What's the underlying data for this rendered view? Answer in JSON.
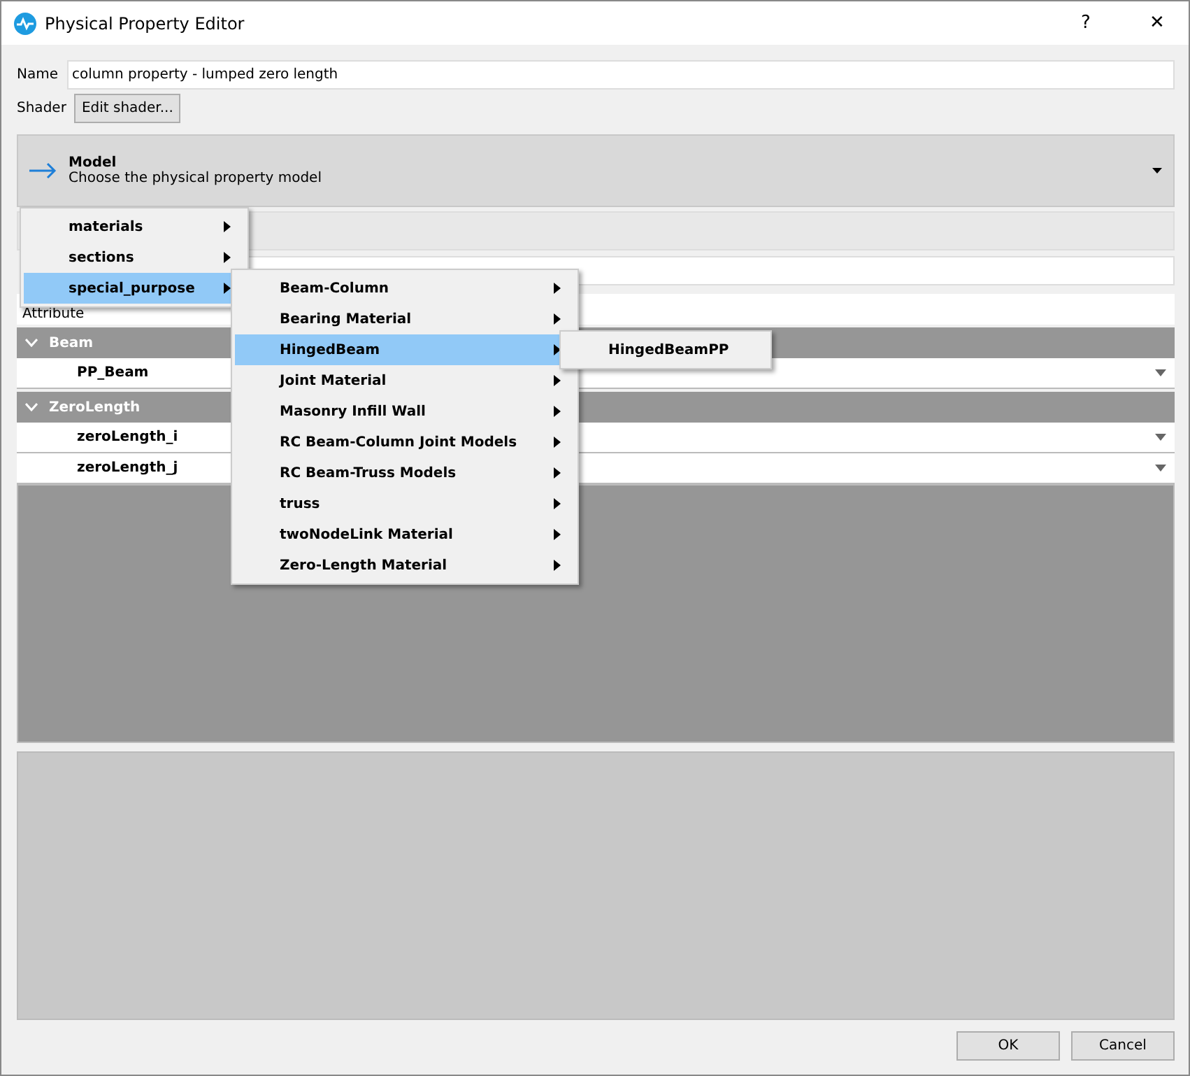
{
  "window": {
    "title": "Physical Property Editor",
    "help": "?",
    "close": "✕"
  },
  "name_field": {
    "label": "Name",
    "value": "column property - lumped zero length"
  },
  "shader": {
    "label": "Shader",
    "button": "Edit shader..."
  },
  "model": {
    "title": "Model",
    "subtitle": "Choose the physical property model"
  },
  "attribute_header": "Attribute",
  "tree": [
    {
      "label": "Beam",
      "expanded": true,
      "children": [
        {
          "label": "PP_Beam"
        }
      ]
    },
    {
      "label": "ZeroLength",
      "expanded": true,
      "children": [
        {
          "label": "zeroLength_i"
        },
        {
          "label": "zeroLength_j"
        }
      ]
    }
  ],
  "menus": [
    [
      {
        "label": "materials",
        "selected": false,
        "submenu": true
      },
      {
        "label": "sections",
        "selected": false,
        "submenu": true
      },
      {
        "label": "special_purpose",
        "selected": true,
        "submenu": true
      }
    ],
    [
      {
        "label": "Beam-Column",
        "selected": false,
        "submenu": true
      },
      {
        "label": "Bearing Material",
        "selected": false,
        "submenu": true
      },
      {
        "label": "HingedBeam",
        "selected": true,
        "submenu": true
      },
      {
        "label": "Joint Material",
        "selected": false,
        "submenu": true
      },
      {
        "label": "Masonry Infill Wall",
        "selected": false,
        "submenu": true
      },
      {
        "label": "RC Beam-Column Joint Models",
        "selected": false,
        "submenu": true
      },
      {
        "label": "RC Beam-Truss Models",
        "selected": false,
        "submenu": true
      },
      {
        "label": "truss",
        "selected": false,
        "submenu": true
      },
      {
        "label": "twoNodeLink Material",
        "selected": false,
        "submenu": true
      },
      {
        "label": "Zero-Length Material",
        "selected": false,
        "submenu": true
      }
    ],
    [
      {
        "label": "HingedBeamPP",
        "selected": false,
        "submenu": false
      }
    ]
  ],
  "buttons": [
    "OK",
    "Cancel"
  ]
}
